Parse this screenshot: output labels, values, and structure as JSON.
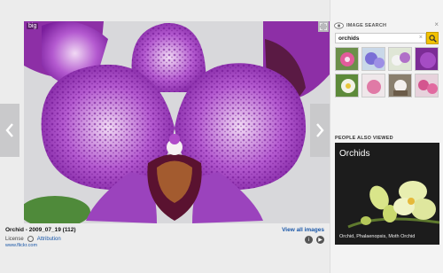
{
  "viewer": {
    "size_badge": "big",
    "caption_title": "Orchid - 2009_07_19 (112)",
    "view_all": "View all images",
    "license_label": "License",
    "attribution": "Attribution",
    "source": "www.flickr.com"
  },
  "panel": {
    "title": "IMAGE SEARCH",
    "search_value": "orchids",
    "people_also_viewed": "PEOPLE ALSO VIEWED",
    "related": {
      "title": "Orchids",
      "description": "Orchid, Phalaenopsis, Moth Orchid"
    }
  },
  "colors": {
    "accent": "#f2c200",
    "link": "#1a57a8",
    "orchid": "#8b2fb0"
  },
  "icons": [
    "chevron-left-icon",
    "chevron-right-icon",
    "expand-icon",
    "search-icon",
    "close-icon",
    "info-icon",
    "play-icon",
    "eye-icon"
  ]
}
